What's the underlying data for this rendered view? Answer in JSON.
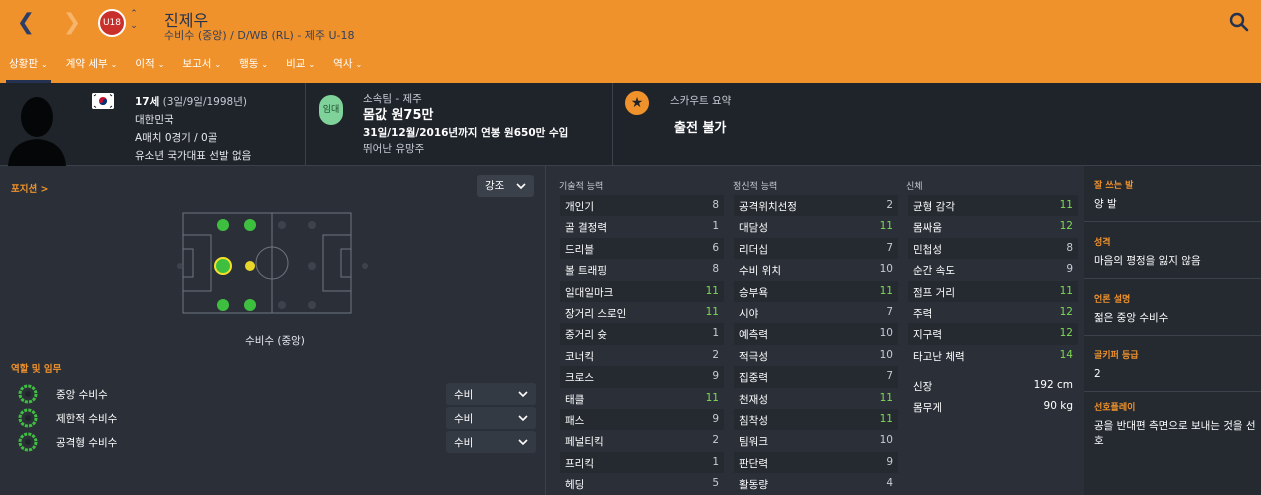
{
  "header": {
    "player_name": "진제우",
    "player_sub": "수비수 (중앙) / D/WB (RL) - 제주 U-18",
    "badge_text": "U18",
    "tabs": [
      {
        "label": "상황판",
        "active": true
      },
      {
        "label": "계약 세부",
        "active": false
      },
      {
        "label": "이적",
        "active": false
      },
      {
        "label": "보고서",
        "active": false
      },
      {
        "label": "행동",
        "active": false
      },
      {
        "label": "비교",
        "active": false
      },
      {
        "label": "역사",
        "active": false
      }
    ],
    "accent": "#f0922b"
  },
  "info": {
    "age": "17세",
    "dob": "(3일/9일/1998년)",
    "nation": "대한민국",
    "caps": "A매치 0경기 / 0골",
    "youth": "유소년 국가대표 선발 없음",
    "club_circle": "임대",
    "club_label": "소속팀 - 제주",
    "value": "몸값 원75만",
    "contract": "31일/12월/2016년까지 연봉 원650만 수입",
    "prospect": "뛰어난 유망주",
    "scout_label": "스카우트 요약",
    "scout_value": "출전 불가"
  },
  "positions": {
    "title": "포지션 >",
    "highlight_label": "강조",
    "position_label": "수비수 (중앙)"
  },
  "roles": {
    "title": "역할 및 임무",
    "items": [
      {
        "name": "중앙 수비수",
        "duty": "수비"
      },
      {
        "name": "제한적 수비수",
        "duty": "수비"
      },
      {
        "name": "공격형 수비수",
        "duty": "수비"
      }
    ]
  },
  "technical": {
    "title": "기술적 능력",
    "rows": [
      {
        "name": "개인기",
        "value": "8"
      },
      {
        "name": "골 결정력",
        "value": "1"
      },
      {
        "name": "드리블",
        "value": "6"
      },
      {
        "name": "볼 트래핑",
        "value": "8"
      },
      {
        "name": "일대일마크",
        "value": "11"
      },
      {
        "name": "장거리 스로인",
        "value": "11"
      },
      {
        "name": "중거리 슛",
        "value": "1"
      },
      {
        "name": "코너킥",
        "value": "2"
      },
      {
        "name": "크로스",
        "value": "9"
      },
      {
        "name": "태클",
        "value": "11"
      },
      {
        "name": "패스",
        "value": "9"
      },
      {
        "name": "페널티킥",
        "value": "2"
      },
      {
        "name": "프리킥",
        "value": "1"
      },
      {
        "name": "헤딩",
        "value": "5"
      }
    ]
  },
  "mental": {
    "title": "정신적 능력",
    "rows": [
      {
        "name": "공격위치선정",
        "value": "2"
      },
      {
        "name": "대담성",
        "value": "11"
      },
      {
        "name": "리더십",
        "value": "7"
      },
      {
        "name": "수비 위치",
        "value": "10"
      },
      {
        "name": "승부욕",
        "value": "11"
      },
      {
        "name": "시야",
        "value": "7"
      },
      {
        "name": "예측력",
        "value": "10"
      },
      {
        "name": "적극성",
        "value": "10"
      },
      {
        "name": "집중력",
        "value": "7"
      },
      {
        "name": "천재성",
        "value": "11"
      },
      {
        "name": "침착성",
        "value": "11"
      },
      {
        "name": "팀워크",
        "value": "10"
      },
      {
        "name": "판단력",
        "value": "9"
      },
      {
        "name": "활동량",
        "value": "4"
      }
    ]
  },
  "physical": {
    "title": "신체",
    "rows": [
      {
        "name": "균형 감각",
        "value": "11"
      },
      {
        "name": "몸싸움",
        "value": "12"
      },
      {
        "name": "민첩성",
        "value": "8"
      },
      {
        "name": "순간 속도",
        "value": "9"
      },
      {
        "name": "점프 거리",
        "value": "11"
      },
      {
        "name": "주력",
        "value": "12"
      },
      {
        "name": "지구력",
        "value": "12"
      },
      {
        "name": "타고난 체력",
        "value": "14"
      }
    ],
    "height_label": "신장",
    "height_value": "192 cm",
    "weight_label": "몸무게",
    "weight_value": "90 kg"
  },
  "side": {
    "foot_title": "잘 쓰는 발",
    "foot_value": "양 발",
    "personality_title": "성격",
    "personality_value": "마음의 평정을 잃지 않음",
    "media_title": "언론 설명",
    "media_value": "젊은 중앙 수비수",
    "gk_title": "골키퍼 등급",
    "gk_value": "2",
    "playstyle_title": "선호플레이",
    "playstyle_value": "공을 반대편 측면으로 보내는 것을 선호"
  }
}
